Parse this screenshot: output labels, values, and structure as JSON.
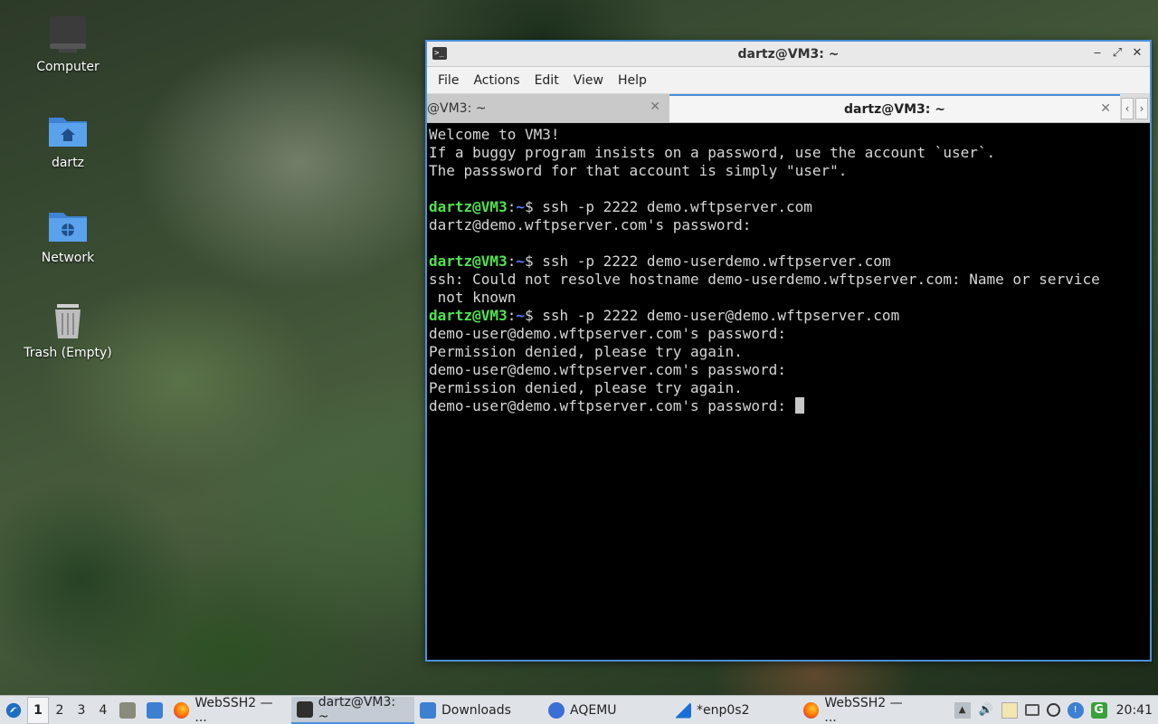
{
  "desktop": {
    "icons": [
      {
        "label": "Computer",
        "icon": "computer-icon"
      },
      {
        "label": "dartz",
        "icon": "home-folder-icon"
      },
      {
        "label": "Network",
        "icon": "network-folder-icon"
      },
      {
        "label": "Trash (Empty)",
        "icon": "trash-icon"
      }
    ]
  },
  "window": {
    "title": "dartz@VM3: ~",
    "controls": {
      "minimize": "‒",
      "maximize": "⤢",
      "close": "✕"
    },
    "menu": [
      "File",
      "Actions",
      "Edit",
      "View",
      "Help"
    ],
    "tabs": [
      {
        "label": "@VM3: ~",
        "active": false
      },
      {
        "label": "dartz@VM3: ~",
        "active": true
      }
    ],
    "tab_close": "✕",
    "tab_nav": {
      "left": "‹",
      "right": "›"
    }
  },
  "terminal": {
    "prompt_user": "dartz@VM3",
    "prompt_sep": ":",
    "prompt_path": "~",
    "prompt_end": "$ ",
    "lines": [
      {
        "text": "Welcome to VM3!"
      },
      {
        "text": "If a buggy program insists on a password, use the account `user`."
      },
      {
        "text": "The passsword for that account is simply \"user\"."
      },
      {
        "text": ""
      },
      {
        "prompt": true,
        "text": "ssh -p 2222 demo.wftpserver.com"
      },
      {
        "text": "dartz@demo.wftpserver.com's password:"
      },
      {
        "text": ""
      },
      {
        "prompt": true,
        "text": "ssh -p 2222 demo-userdemo.wftpserver.com"
      },
      {
        "text": "ssh: Could not resolve hostname demo-userdemo.wftpserver.com: Name or service"
      },
      {
        "text": " not known"
      },
      {
        "prompt": true,
        "text": "ssh -p 2222 demo-user@demo.wftpserver.com"
      },
      {
        "text": "demo-user@demo.wftpserver.com's password:"
      },
      {
        "text": "Permission denied, please try again."
      },
      {
        "text": "demo-user@demo.wftpserver.com's password:"
      },
      {
        "text": "Permission denied, please try again."
      },
      {
        "text": "demo-user@demo.wftpserver.com's password: ",
        "cursor": true
      }
    ]
  },
  "taskbar": {
    "workspaces": [
      "1",
      "2",
      "3",
      "4"
    ],
    "active_workspace": "1",
    "tasks": [
      {
        "label": "WebSSH2 — ...",
        "icon": "firefox-icon",
        "active": false
      },
      {
        "label": "dartz@VM3: ~",
        "icon": "terminal-icon",
        "active": true
      },
      {
        "label": "Downloads",
        "icon": "folder-icon",
        "active": false
      },
      {
        "label": "AQEMU",
        "icon": "aqemu-icon",
        "active": false
      },
      {
        "label": "*enp0s2",
        "icon": "wireshark-icon",
        "active": false
      },
      {
        "label": "WebSSH2 — ...",
        "icon": "firefox-icon",
        "active": false
      }
    ],
    "clock": "20:41"
  },
  "colors": {
    "accent": "#4a90d9",
    "prompt_user": "#4ee44e",
    "prompt_path": "#5b7cff",
    "terminal_bg": "#000000",
    "terminal_fg": "#d6d6d6"
  }
}
